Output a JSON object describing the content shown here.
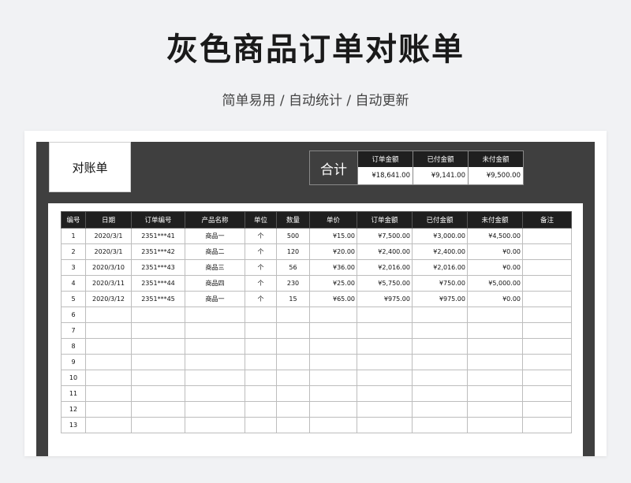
{
  "header": {
    "title": "灰色商品订单对账单",
    "subtitle": "简单易用 / 自动统计 / 自动更新"
  },
  "sheet": {
    "label": "对账单",
    "summary": {
      "label": "合计",
      "columns": [
        {
          "header": "订单金额",
          "value": "¥18,641.00"
        },
        {
          "header": "已付金额",
          "value": "¥9,141.00"
        },
        {
          "header": "未付金额",
          "value": "¥9,500.00"
        }
      ]
    },
    "table": {
      "headers": [
        "编号",
        "日期",
        "订单编号",
        "产品名称",
        "单位",
        "数量",
        "单价",
        "订单金额",
        "已付金额",
        "未付金额",
        "备注"
      ],
      "rows": [
        [
          "1",
          "2020/3/1",
          "2351***41",
          "商品一",
          "个",
          "500",
          "¥15.00",
          "¥7,500.00",
          "¥3,000.00",
          "¥4,500.00",
          ""
        ],
        [
          "2",
          "2020/3/1",
          "2351***42",
          "商品二",
          "个",
          "120",
          "¥20.00",
          "¥2,400.00",
          "¥2,400.00",
          "¥0.00",
          ""
        ],
        [
          "3",
          "2020/3/10",
          "2351***43",
          "商品三",
          "个",
          "56",
          "¥36.00",
          "¥2,016.00",
          "¥2,016.00",
          "¥0.00",
          ""
        ],
        [
          "4",
          "2020/3/11",
          "2351***44",
          "商品四",
          "个",
          "230",
          "¥25.00",
          "¥5,750.00",
          "¥750.00",
          "¥5,000.00",
          ""
        ],
        [
          "5",
          "2020/3/12",
          "2351***45",
          "商品一",
          "个",
          "15",
          "¥65.00",
          "¥975.00",
          "¥975.00",
          "¥0.00",
          ""
        ],
        [
          "6",
          "",
          "",
          "",
          "",
          "",
          "",
          "",
          "",
          "",
          ""
        ],
        [
          "7",
          "",
          "",
          "",
          "",
          "",
          "",
          "",
          "",
          "",
          ""
        ],
        [
          "8",
          "",
          "",
          "",
          "",
          "",
          "",
          "",
          "",
          "",
          ""
        ],
        [
          "9",
          "",
          "",
          "",
          "",
          "",
          "",
          "",
          "",
          "",
          ""
        ],
        [
          "10",
          "",
          "",
          "",
          "",
          "",
          "",
          "",
          "",
          "",
          ""
        ],
        [
          "11",
          "",
          "",
          "",
          "",
          "",
          "",
          "",
          "",
          "",
          ""
        ],
        [
          "12",
          "",
          "",
          "",
          "",
          "",
          "",
          "",
          "",
          "",
          ""
        ],
        [
          "13",
          "",
          "",
          "",
          "",
          "",
          "",
          "",
          "",
          "",
          ""
        ]
      ]
    }
  }
}
